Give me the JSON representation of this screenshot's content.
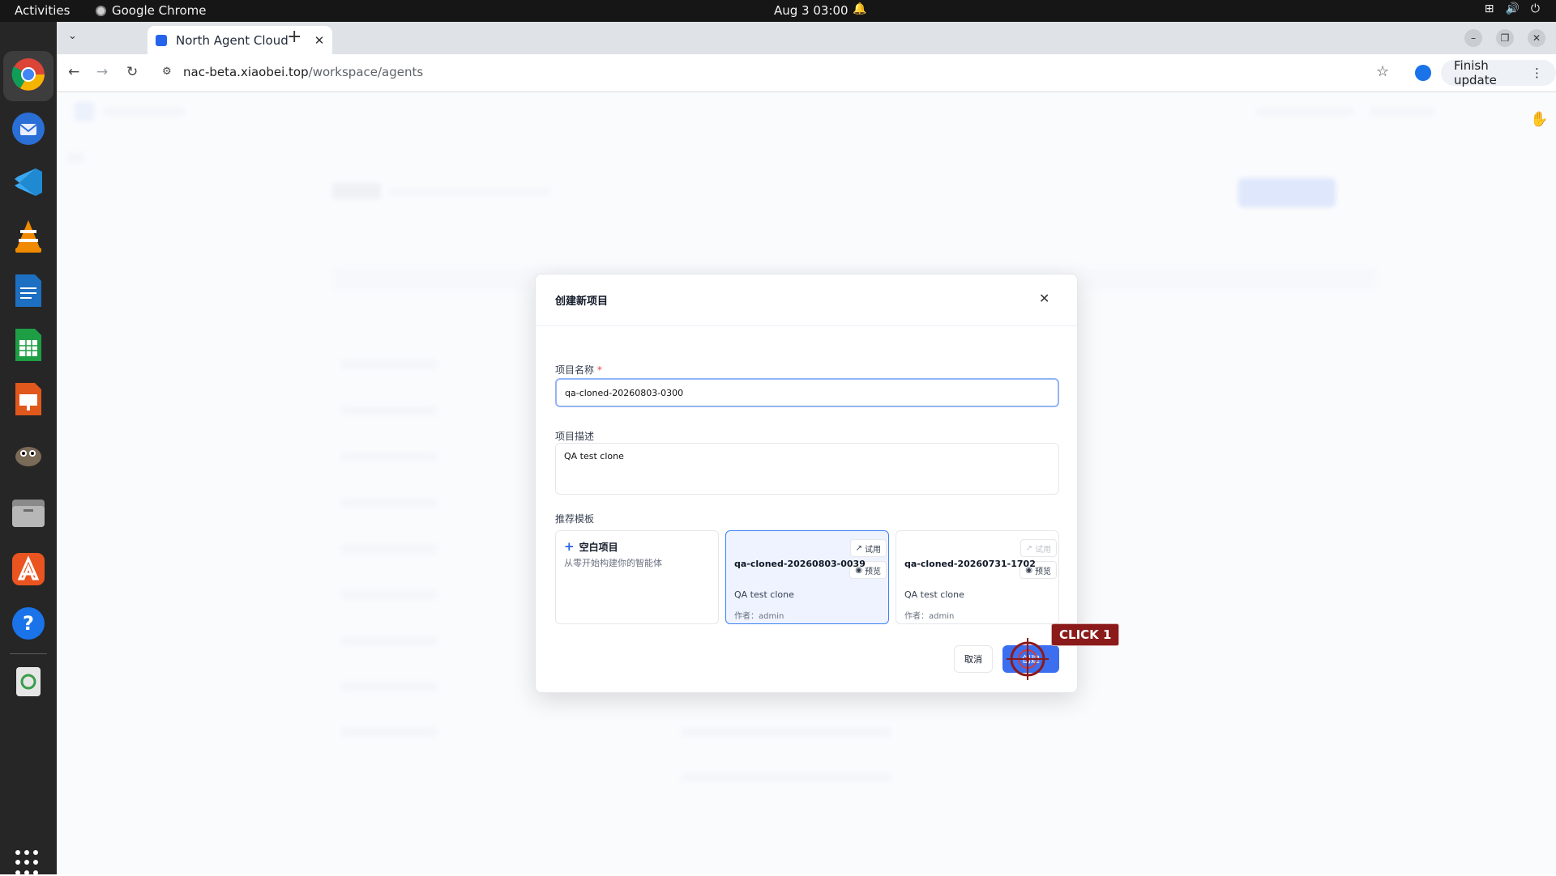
{
  "system": {
    "activities": "Activities",
    "app_name": "Google Chrome",
    "clock": "Aug 3  03:00"
  },
  "browser": {
    "tab_title": "North Agent Cloud",
    "url_host": "nac-beta.xiaobei.top",
    "url_path": "/workspace/agents",
    "finish_update": "Finish update"
  },
  "dialog": {
    "title": "创建新项目",
    "name_label": "项目名称",
    "required_mark": "*",
    "name_value": "qa-cloned-20260803-0300",
    "desc_label": "项目描述",
    "desc_value": "QA test clone",
    "templates_label": "推荐模板",
    "blank_card": {
      "title": "空白项目",
      "desc": "从零开始构建你的智能体"
    },
    "template_cards": [
      {
        "title": "qa-cloned-20260803-0039",
        "desc": "QA test clone",
        "author": "作者：admin",
        "try_label": "试用",
        "preview_label": "预览",
        "selected": true
      },
      {
        "title": "qa-cloned-20260731-1702",
        "desc": "QA test clone",
        "author": "作者：admin",
        "try_label": "试用",
        "preview_label": "预览",
        "selected": false
      }
    ],
    "cancel_label": "取消",
    "create_label": "创建"
  },
  "annotation": {
    "click_label": "CLICK 1"
  },
  "colors": {
    "primary": "#3b6ff0",
    "selected_card_bg": "#eef3ff",
    "required": "#ef4444",
    "annotation": "#8b1a1a"
  }
}
